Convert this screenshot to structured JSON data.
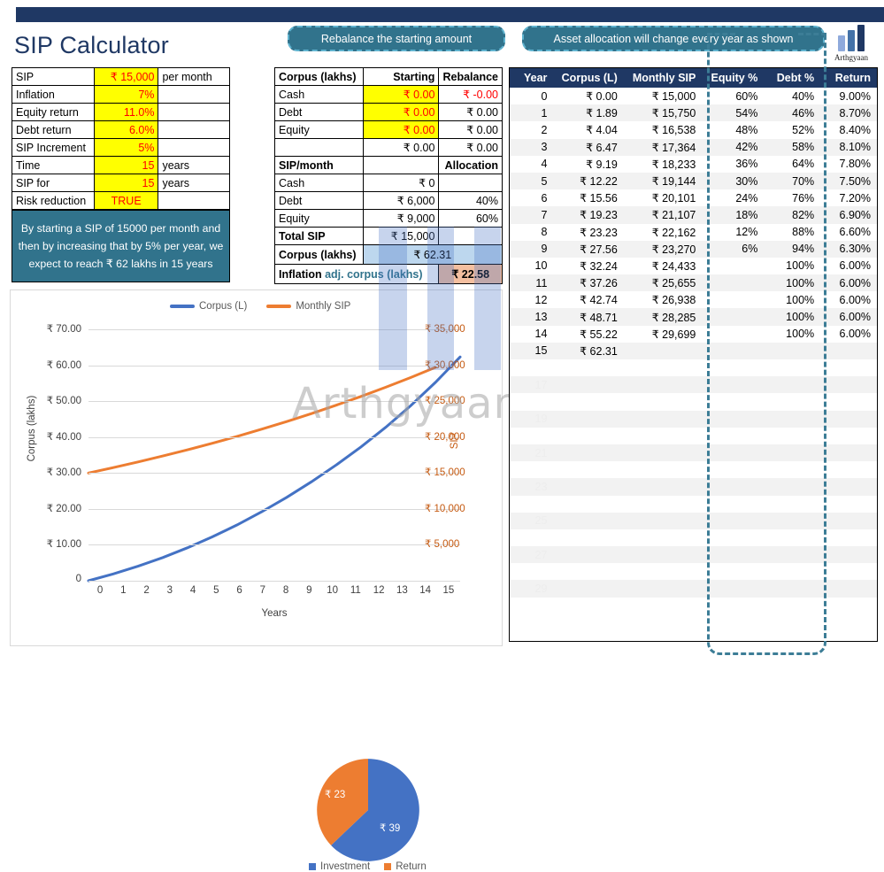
{
  "page": {
    "title": "SIP Calculator",
    "accent_dark": "#1F3864",
    "accent_teal": "#31738C",
    "highlight_yellow": "#FFFF00",
    "value_red": "#FF0000",
    "series_blue": "#4472C4",
    "series_orange": "#ED7D31"
  },
  "callouts": {
    "rebalance": "Rebalance the starting amount",
    "allocation": "Asset allocation will change every year as shown"
  },
  "brand": {
    "name": "Arthgyaan",
    "watermark": "Arthgyaan"
  },
  "input_table": {
    "rows": [
      {
        "label": "SIP",
        "value": "₹ 15,000",
        "unit": "per month",
        "align": "right"
      },
      {
        "label": "Inflation",
        "value": "7%",
        "unit": "",
        "align": "right"
      },
      {
        "label": "Equity return",
        "value": "11.0%",
        "unit": "",
        "align": "right"
      },
      {
        "label": "Debt return",
        "value": "6.0%",
        "unit": "",
        "align": "right"
      },
      {
        "label": "SIP Increment",
        "value": "5%",
        "unit": "",
        "align": "right"
      },
      {
        "label": "Time",
        "value": "15",
        "unit": "years",
        "align": "right"
      },
      {
        "label": "SIP for",
        "value": "15",
        "unit": "years",
        "align": "right"
      },
      {
        "label": "Risk reduction",
        "value": "TRUE",
        "unit": "",
        "align": "center"
      }
    ]
  },
  "note": "By starting a SIP of 15000 per month and then by increasing that by 5% per year, we expect to reach ₹ 62 lakhs in 15 years",
  "corpus_table": {
    "header": {
      "c1": "Corpus (lakhs)",
      "c2": "Starting",
      "c3": "Rebalance"
    },
    "rows": [
      {
        "c1": "Cash",
        "c2": "₹ 0.00",
        "c3": "₹ -0.00",
        "yellow": true,
        "c3red": true
      },
      {
        "c1": "Debt",
        "c2": "₹ 0.00",
        "c3": "₹ 0.00",
        "yellow": true,
        "c3red": false
      },
      {
        "c1": "Equity",
        "c2": "₹ 0.00",
        "c3": "₹ 0.00",
        "yellow": true,
        "c3red": false
      },
      {
        "c1": "",
        "c2": "₹ 0.00",
        "c3": "₹ 0.00",
        "yellow": false,
        "c3red": false
      }
    ],
    "sip_header": {
      "c1": "SIP/month",
      "c2": "",
      "c3": "Allocation"
    },
    "sip_rows": [
      {
        "c1": "Cash",
        "c2": "₹ 0",
        "c3": ""
      },
      {
        "c1": "Debt",
        "c2": "₹ 6,000",
        "c3": "40%"
      },
      {
        "c1": "Equity",
        "c2": "₹ 9,000",
        "c3": "60%"
      }
    ],
    "total_label": "Total SIP",
    "total_value": "₹ 15,000",
    "corpus_label": "Corpus (lakhs)",
    "corpus_value": "₹ 62.31",
    "inflation_label_bold": "Inflation",
    "inflation_label_rest": " adj. corpus (lakhs)",
    "inflation_value": "₹ 22.58"
  },
  "year_table": {
    "columns": [
      "Year",
      "Corpus (L)",
      "Monthly SIP",
      "Equity %",
      "Debt %",
      "Return"
    ],
    "rows": [
      [
        "0",
        "₹ 0.00",
        "₹ 15,000",
        "60%",
        "40%",
        "9.00%"
      ],
      [
        "1",
        "₹ 1.89",
        "₹ 15,750",
        "54%",
        "46%",
        "8.70%"
      ],
      [
        "2",
        "₹ 4.04",
        "₹ 16,538",
        "48%",
        "52%",
        "8.40%"
      ],
      [
        "3",
        "₹ 6.47",
        "₹ 17,364",
        "42%",
        "58%",
        "8.10%"
      ],
      [
        "4",
        "₹ 9.19",
        "₹ 18,233",
        "36%",
        "64%",
        "7.80%"
      ],
      [
        "5",
        "₹ 12.22",
        "₹ 19,144",
        "30%",
        "70%",
        "7.50%"
      ],
      [
        "6",
        "₹ 15.56",
        "₹ 20,101",
        "24%",
        "76%",
        "7.20%"
      ],
      [
        "7",
        "₹ 19.23",
        "₹ 21,107",
        "18%",
        "82%",
        "6.90%"
      ],
      [
        "8",
        "₹ 23.23",
        "₹ 22,162",
        "12%",
        "88%",
        "6.60%"
      ],
      [
        "9",
        "₹ 27.56",
        "₹ 23,270",
        "6%",
        "94%",
        "6.30%"
      ],
      [
        "10",
        "₹ 32.24",
        "₹ 24,433",
        "",
        "100%",
        "6.00%"
      ],
      [
        "11",
        "₹ 37.26",
        "₹ 25,655",
        "",
        "100%",
        "6.00%"
      ],
      [
        "12",
        "₹ 42.74",
        "₹ 26,938",
        "",
        "100%",
        "6.00%"
      ],
      [
        "13",
        "₹ 48.71",
        "₹ 28,285",
        "",
        "100%",
        "6.00%"
      ],
      [
        "14",
        "₹ 55.22",
        "₹ 29,699",
        "",
        "100%",
        "6.00%"
      ],
      [
        "15",
        "₹ 62.31",
        "",
        "",
        "",
        ""
      ]
    ],
    "ghost_rows": [
      "17",
      "19",
      "21",
      "23",
      "25",
      "27",
      "29"
    ]
  },
  "chart_data": {
    "type": "line",
    "title": "",
    "xlabel": "Years",
    "ylabel": "Corpus (lakhs)",
    "ylabel_right": "SIP",
    "x": [
      0,
      1,
      2,
      3,
      4,
      5,
      6,
      7,
      8,
      9,
      10,
      11,
      12,
      13,
      14,
      15
    ],
    "xtick_labels": [
      "0",
      "1",
      "2",
      "3",
      "4",
      "5",
      "6",
      "7",
      "8",
      "9",
      "10",
      "11",
      "12",
      "13",
      "14",
      "15"
    ],
    "ylim": [
      0,
      70
    ],
    "ytick_labels": [
      "₹ 70.00",
      "₹ 60.00",
      "₹ 50.00",
      "₹ 40.00",
      "₹ 30.00",
      "₹ 20.00",
      "₹ 10.00",
      "0"
    ],
    "ytick_values": [
      70,
      60,
      50,
      40,
      30,
      20,
      10,
      0
    ],
    "ylim_right": [
      0,
      35000
    ],
    "ytick_labels_right": [
      "₹ 35,000",
      "₹ 30,000",
      "₹ 25,000",
      "₹ 20,000",
      "₹ 15,000",
      "₹ 10,000",
      "₹ 5,000"
    ],
    "ytick_values_right": [
      35000,
      30000,
      25000,
      20000,
      15000,
      10000,
      5000
    ],
    "grid": true,
    "legend_position": "top",
    "series": [
      {
        "name": "Corpus (L)",
        "color": "#4472C4",
        "axis": "left",
        "values": [
          0,
          1.89,
          4.04,
          6.47,
          9.19,
          12.22,
          15.56,
          19.23,
          23.23,
          27.56,
          32.24,
          37.26,
          42.74,
          48.71,
          55.22,
          62.31
        ]
      },
      {
        "name": "Monthly SIP",
        "color": "#ED7D31",
        "axis": "right",
        "values": [
          15000,
          15750,
          16538,
          17364,
          18233,
          19144,
          20101,
          21107,
          22162,
          23270,
          24433,
          25655,
          26938,
          28285,
          29699,
          29699
        ]
      }
    ]
  },
  "pie_chart": {
    "type": "pie",
    "labels": [
      "Investment",
      "Return"
    ],
    "values": [
      39,
      23
    ],
    "display_labels": [
      "₹ 39",
      "₹ 23"
    ],
    "colors": [
      "#4472C4",
      "#ED7D31"
    ],
    "legend_position": "bottom"
  }
}
